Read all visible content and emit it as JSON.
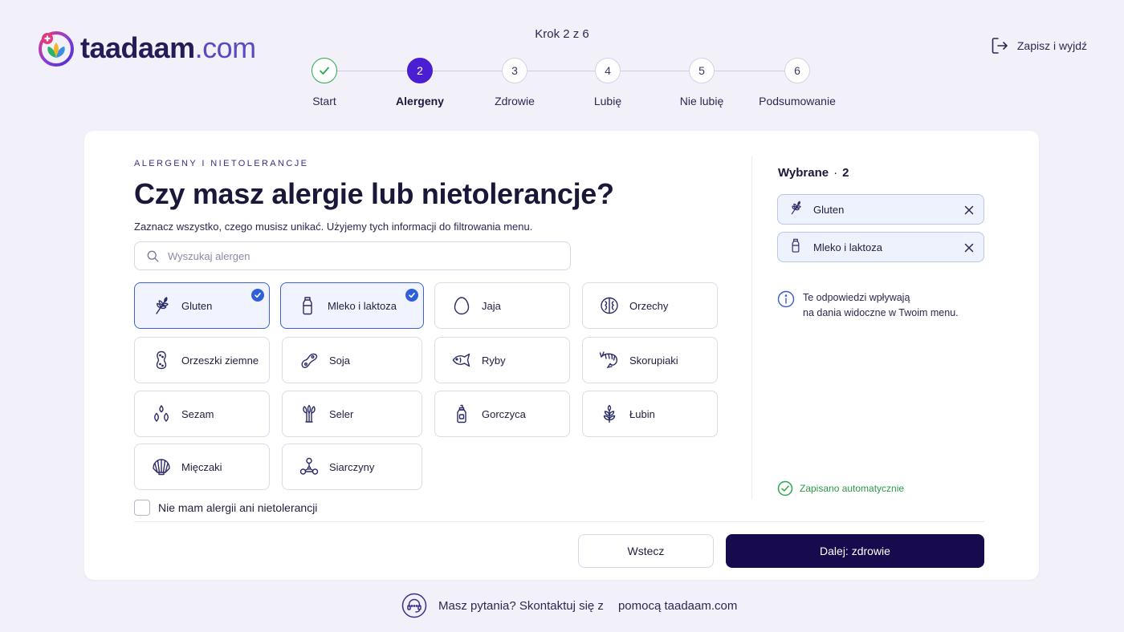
{
  "brand": {
    "name": "taadaam",
    "domain": ".com"
  },
  "header": {
    "step_counter": "Krok 2 z 6",
    "save_exit": "Zapisz i wyjdź"
  },
  "stepper": [
    {
      "num": "",
      "label": "Start",
      "state": "done"
    },
    {
      "num": "2",
      "label": "Alergeny",
      "state": "active"
    },
    {
      "num": "3",
      "label": "Zdrowie",
      "state": "todo"
    },
    {
      "num": "4",
      "label": "Lubię",
      "state": "todo"
    },
    {
      "num": "5",
      "label": "Nie lubię",
      "state": "todo"
    },
    {
      "num": "6",
      "label": "Podsumowanie",
      "state": "todo"
    }
  ],
  "main": {
    "eyebrow": "ALERGENY I NIETOLERANCJE",
    "title": "Czy masz alergie lub nietolerancje?",
    "subtitle": "Zaznacz wszystko, czego musisz unikać. Użyjemy tych informacji do filtrowania menu.",
    "search_placeholder": "Wyszukaj alergen",
    "allergens": [
      {
        "label": "Gluten",
        "icon": "wheat-icon",
        "selected": true
      },
      {
        "label": "Mleko i laktoza",
        "icon": "milk-bottle-icon",
        "selected": true
      },
      {
        "label": "Jaja",
        "icon": "egg-icon",
        "selected": false
      },
      {
        "label": "Orzechy",
        "icon": "walnut-icon",
        "selected": false
      },
      {
        "label": "Orzeszki ziemne",
        "icon": "peanut-icon",
        "selected": false
      },
      {
        "label": "Soja",
        "icon": "soy-bean-icon",
        "selected": false
      },
      {
        "label": "Ryby",
        "icon": "fish-icon",
        "selected": false
      },
      {
        "label": "Skorupiaki",
        "icon": "shrimp-icon",
        "selected": false
      },
      {
        "label": "Sezam",
        "icon": "sesame-icon",
        "selected": false
      },
      {
        "label": "Seler",
        "icon": "celery-icon",
        "selected": false
      },
      {
        "label": "Gorczyca",
        "icon": "mustard-bottle-icon",
        "selected": false
      },
      {
        "label": "Łubin",
        "icon": "lupin-icon",
        "selected": false
      },
      {
        "label": "Mięczaki",
        "icon": "shell-icon",
        "selected": false
      },
      {
        "label": "Siarczyny",
        "icon": "molecule-icon",
        "selected": false
      }
    ],
    "none_label": "Nie mam alergii ani nietolerancji"
  },
  "selected_panel": {
    "heading": "Wybrane",
    "count": "2",
    "chips": [
      {
        "label": "Gluten",
        "icon": "wheat-icon"
      },
      {
        "label": "Mleko i laktoza",
        "icon": "milk-bottle-icon"
      }
    ],
    "info_line1": "Te odpowiedzi wpływają",
    "info_line2": "na dania widoczne w Twoim menu.",
    "autosave": "Zapisano automatycznie"
  },
  "actions": {
    "back": "Wstecz",
    "next": "Dalej: zdrowie"
  },
  "footer": {
    "text": "Masz pytania? Skontaktuj się z",
    "link": "pomocą taadaam.com"
  },
  "colors": {
    "accent": "#4a1fd1",
    "primary_button": "#170b4d",
    "selected_border": "#3f5fd6",
    "success": "#2aa84a"
  }
}
